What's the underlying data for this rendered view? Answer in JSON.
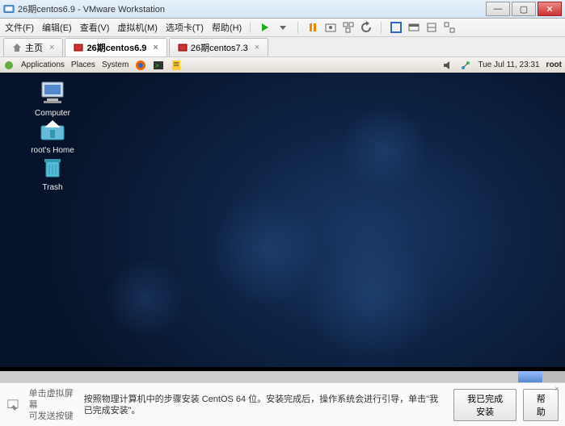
{
  "window": {
    "title": "26期centos6.9 - VMware Workstation"
  },
  "menu": {
    "file": "文件(F)",
    "edit": "编辑(E)",
    "view": "查看(V)",
    "vm": "虚拟机(M)",
    "tabs": "选项卡(T)",
    "help": "帮助(H)"
  },
  "tabs": {
    "home": "主页",
    "t1": "26期centos6.9",
    "t2": "26期centos7.3"
  },
  "gnome": {
    "apps": "Applications",
    "places": "Places",
    "system": "System",
    "datetime": "Tue Jul 11, 23:31",
    "user": "root"
  },
  "desktop": {
    "computer": "Computer",
    "home": "root's Home",
    "trash": "Trash"
  },
  "status": {
    "hint_l1": "单击虚拟屏幕",
    "hint_l2": "可发送按键",
    "msg": "按照物理计算机中的步骤安装 CentOS 64 位。安装完成后，操作系统会进行引导，单击\"我已完成安装\"。",
    "done": "我已完成安装",
    "help": "帮助"
  }
}
